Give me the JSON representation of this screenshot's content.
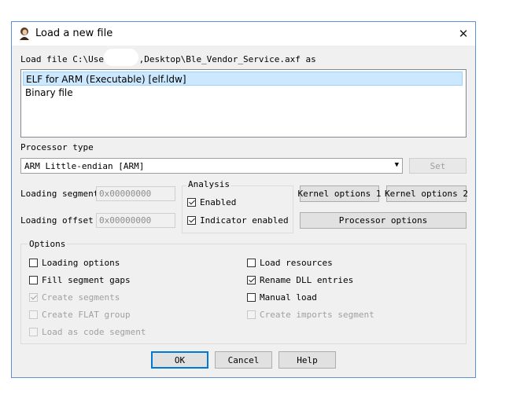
{
  "window": {
    "title": "Load a new file",
    "close_glyph": "✕"
  },
  "load_file_label": "Load file C:\\User",
  "load_file_label_tail": ",Desktop\\Ble_Vendor_Service.axf as",
  "file_types": [
    "ELF for ARM (Executable) [elf.ldw]",
    "Binary file"
  ],
  "selected_file_type": 0,
  "processor_type": {
    "label": "Processor type",
    "value": "ARM Little-endian [ARM]",
    "set_label": "Set"
  },
  "loading_segment": {
    "label": "Loading segment",
    "value": "0x00000000"
  },
  "loading_offset": {
    "label": "Loading offset",
    "value": "0x00000000"
  },
  "analysis": {
    "title": "Analysis",
    "enabled": "Enabled",
    "indicator": "Indicator enabled"
  },
  "buttons": {
    "kernel1": "Kernel options 1",
    "kernel2": "Kernel options 2",
    "processor": "Processor options",
    "ok": "OK",
    "cancel": "Cancel",
    "help": "Help"
  },
  "options": {
    "title": "Options",
    "left": [
      {
        "label": "Loading options",
        "checked": false,
        "disabled": false
      },
      {
        "label": "Fill segment gaps",
        "checked": false,
        "disabled": false
      },
      {
        "label": "Create segments",
        "checked": true,
        "disabled": true
      },
      {
        "label": "Create FLAT group",
        "checked": false,
        "disabled": true
      },
      {
        "label": "Load as code segment",
        "checked": false,
        "disabled": true
      }
    ],
    "right": [
      {
        "label": "Load resources",
        "checked": false,
        "disabled": false
      },
      {
        "label": "Rename DLL entries",
        "checked": true,
        "disabled": false
      },
      {
        "label": "Manual load",
        "checked": false,
        "disabled": false
      },
      {
        "label": "Create imports segment",
        "checked": false,
        "disabled": true
      }
    ]
  }
}
